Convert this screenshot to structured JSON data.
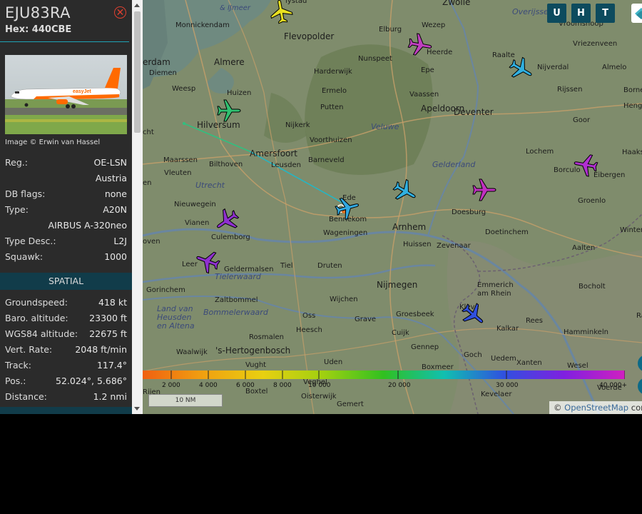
{
  "aircraft": {
    "callsign": "EJU83RA",
    "hex": "Hex: 440CBE",
    "photo_credit": "Image © Erwin van Hassel",
    "photo_livery_text": "easyJet",
    "info_rows": [
      {
        "label": "Reg.:",
        "value": "OE-LSN"
      },
      {
        "label": "",
        "value": "Austria"
      },
      {
        "label": "DB flags:",
        "value": "none"
      },
      {
        "label": "Type:",
        "value": "A20N"
      },
      {
        "label": "",
        "value": "AIRBUS A-320neo"
      },
      {
        "label": "Type Desc.:",
        "value": "L2J"
      },
      {
        "label": "Squawk:",
        "value": "1000"
      }
    ],
    "spatial_header": "SPATIAL",
    "spatial_rows": [
      {
        "label": "Groundspeed:",
        "value": "418 kt"
      },
      {
        "label": "Baro. altitude:",
        "value": "23300 ft"
      },
      {
        "label": "WGS84 altitude:",
        "value": "22675 ft"
      },
      {
        "label": "Vert. Rate:",
        "value": "2048 ft/min"
      },
      {
        "label": "Track:",
        "value": "117.4°"
      },
      {
        "label": "Pos.:",
        "value": "52.024°, 5.686°"
      },
      {
        "label": "Distance:",
        "value": "1.2 nmi"
      }
    ],
    "close_icon": "close-icon"
  },
  "map_buttons": {
    "u": "U",
    "h": "H",
    "t": "T",
    "layers_icon": "layers-icon"
  },
  "altitude_legend": {
    "labels": [
      "2 000",
      "4 000",
      "6 000",
      "8 000",
      "10 000",
      "20 000",
      "30 000",
      "40 000+"
    ],
    "colors": [
      "#f06010",
      "#f0a010",
      "#e8d010",
      "#a0d010",
      "#30c020",
      "#10c0b0",
      "#3050e0",
      "#8020e0",
      "#d020c0"
    ]
  },
  "scale_label": "10 NM",
  "attribution": {
    "copyright": "©",
    "link": "OpenStreetMap",
    "rest": "cor"
  },
  "places": [
    {
      "name": "lystad",
      "cls": "place"
    },
    {
      "name": "& IJmeer",
      "cls": "place water"
    },
    {
      "name": "Zwolle",
      "cls": "place big"
    },
    {
      "name": "Overijsse",
      "cls": "place region"
    },
    {
      "name": "Vroomshoop",
      "cls": "place"
    },
    {
      "name": "Monnickendam",
      "cls": "place"
    },
    {
      "name": "Flevopolder",
      "cls": "place big"
    },
    {
      "name": "Wezep",
      "cls": "place"
    },
    {
      "name": "Elburg",
      "cls": "place"
    },
    {
      "name": "Heerde",
      "cls": "place"
    },
    {
      "name": "Raalte",
      "cls": "place"
    },
    {
      "name": "Vriezenveen",
      "cls": "place"
    },
    {
      "name": "erdam",
      "cls": "place big"
    },
    {
      "name": "Almere",
      "cls": "place big"
    },
    {
      "name": "Nunspeet",
      "cls": "place"
    },
    {
      "name": "Nijverdal",
      "cls": "place"
    },
    {
      "name": "Almelo",
      "cls": "place"
    },
    {
      "name": "Diemen",
      "cls": "place"
    },
    {
      "name": "Harderwijk",
      "cls": "place"
    },
    {
      "name": "Epe",
      "cls": "place"
    },
    {
      "name": "Weesp",
      "cls": "place"
    },
    {
      "name": "Ermelo",
      "cls": "place"
    },
    {
      "name": "Rijssen",
      "cls": "place"
    },
    {
      "name": "Borne",
      "cls": "place"
    },
    {
      "name": "Huizen",
      "cls": "place"
    },
    {
      "name": "Vaassen",
      "cls": "place"
    },
    {
      "name": "Hengl",
      "cls": "place"
    },
    {
      "name": "Putten",
      "cls": "place"
    },
    {
      "name": "Deventer",
      "cls": "place big"
    },
    {
      "name": "Hilversum",
      "cls": "place big"
    },
    {
      "name": "Nijkerk",
      "cls": "place"
    },
    {
      "name": "Veluwe",
      "cls": "place region"
    },
    {
      "name": "Apeldoorn",
      "cls": "place big"
    },
    {
      "name": "Goor",
      "cls": "place"
    },
    {
      "name": "cht",
      "cls": "place"
    },
    {
      "name": "Voorthuizen",
      "cls": "place"
    },
    {
      "name": "Amersfoort",
      "cls": "place big"
    },
    {
      "name": "Lochem",
      "cls": "place"
    },
    {
      "name": "Haaksberge",
      "cls": "place"
    },
    {
      "name": "Maarssen",
      "cls": "place"
    },
    {
      "name": "Barneveld",
      "cls": "place"
    },
    {
      "name": "Gelderland",
      "cls": "place region"
    },
    {
      "name": "Bilthoven",
      "cls": "place"
    },
    {
      "name": "Leusden",
      "cls": "place"
    },
    {
      "name": "Borculo",
      "cls": "place"
    },
    {
      "name": "Eibergen",
      "cls": "place"
    },
    {
      "name": "Vleuten",
      "cls": "place"
    },
    {
      "name": "Utrecht",
      "cls": "place region"
    },
    {
      "name": "en",
      "cls": "place"
    },
    {
      "name": "Groenlo",
      "cls": "place"
    },
    {
      "name": "Nieuwegein",
      "cls": "place"
    },
    {
      "name": "Ede",
      "cls": "place"
    },
    {
      "name": "Doesburg",
      "cls": "place"
    },
    {
      "name": "Bennekom",
      "cls": "place"
    },
    {
      "name": "Vianen",
      "cls": "place"
    },
    {
      "name": "Arnhem",
      "cls": "place big"
    },
    {
      "name": "Winterswijk",
      "cls": "place"
    },
    {
      "name": "Wageningen",
      "cls": "place"
    },
    {
      "name": "Doetinchem",
      "cls": "place"
    },
    {
      "name": "Culemborg",
      "cls": "place"
    },
    {
      "name": "oven",
      "cls": "place"
    },
    {
      "name": "Huissen",
      "cls": "place"
    },
    {
      "name": "Zevenaar",
      "cls": "place"
    },
    {
      "name": "Aalten",
      "cls": "place"
    },
    {
      "name": "Leer",
      "cls": "place"
    },
    {
      "name": "Tiel",
      "cls": "place"
    },
    {
      "name": "Druten",
      "cls": "place"
    },
    {
      "name": "Geldermalsen",
      "cls": "place"
    },
    {
      "name": "Tielerwaard",
      "cls": "place region"
    },
    {
      "name": "Nijmegen",
      "cls": "place big"
    },
    {
      "name": "Emmerich",
      "cls": "place"
    },
    {
      "name": "am Rhein",
      "cls": "place"
    },
    {
      "name": "Gorinchem",
      "cls": "place"
    },
    {
      "name": "Bocholt",
      "cls": "place"
    },
    {
      "name": "Zaltbommel",
      "cls": "place"
    },
    {
      "name": "Wijchen",
      "cls": "place"
    },
    {
      "name": "Kleve",
      "cls": "place"
    },
    {
      "name": "Land van",
      "cls": "place region"
    },
    {
      "name": "Heusden",
      "cls": "place region"
    },
    {
      "name": "en Altena",
      "cls": "place region"
    },
    {
      "name": "Bommelerwaard",
      "cls": "place region"
    },
    {
      "name": "Oss",
      "cls": "place"
    },
    {
      "name": "Grave",
      "cls": "place"
    },
    {
      "name": "Groesbeek",
      "cls": "place"
    },
    {
      "name": "Rees",
      "cls": "place"
    },
    {
      "name": "Ra",
      "cls": "place"
    },
    {
      "name": "Heesch",
      "cls": "place"
    },
    {
      "name": "Cuijk",
      "cls": "place"
    },
    {
      "name": "Kalkar",
      "cls": "place"
    },
    {
      "name": "Hamminkeln",
      "cls": "place"
    },
    {
      "name": "Rosmalen",
      "cls": "place"
    },
    {
      "name": "Gennep",
      "cls": "place"
    },
    {
      "name": "Waalwijk",
      "cls": "place"
    },
    {
      "name": "'s-Hertogenbosch",
      "cls": "place big"
    },
    {
      "name": "Goch",
      "cls": "place"
    },
    {
      "name": "Uedem",
      "cls": "place"
    },
    {
      "name": "Xanten",
      "cls": "place"
    },
    {
      "name": "Uden",
      "cls": "place"
    },
    {
      "name": "Wesel",
      "cls": "place"
    },
    {
      "name": "Vught",
      "cls": "place"
    },
    {
      "name": "Boxmeer",
      "cls": "place"
    },
    {
      "name": "Veghel",
      "cls": "place"
    },
    {
      "name": "Voerde",
      "cls": "place"
    },
    {
      "name": "Rijen",
      "cls": "place"
    },
    {
      "name": "Boxtel",
      "cls": "place"
    },
    {
      "name": "Oisterwijk",
      "cls": "place"
    },
    {
      "name": "Gemert",
      "cls": "place"
    },
    {
      "name": "Kevelaer",
      "cls": "place"
    }
  ],
  "planes": [
    {
      "name": "aircraft-yellow",
      "color": "#e8e020",
      "angle": -10
    },
    {
      "name": "aircraft-violet-wezep",
      "color": "#c040c0",
      "angle": 100
    },
    {
      "name": "aircraft-cyan-raalte",
      "color": "#30b0e0",
      "angle": 120
    },
    {
      "name": "aircraft-green-hilversum",
      "color": "#30c070",
      "angle": 90
    },
    {
      "name": "aircraft-magenta-borculo",
      "color": "#b030d0",
      "angle": -80
    },
    {
      "name": "aircraft-cyan-ede",
      "color": "#30a8e0",
      "angle": 75
    },
    {
      "name": "aircraft-cyan-arnhem",
      "color": "#30b0e0",
      "angle": 120
    },
    {
      "name": "aircraft-magenta-doesburg",
      "color": "#c030c0",
      "angle": 90
    },
    {
      "name": "aircraft-purple-culemborg",
      "color": "#9030d0",
      "angle": -125
    },
    {
      "name": "aircraft-purple-leer",
      "color": "#9030d0",
      "angle": -70
    },
    {
      "name": "aircraft-blue-kleve",
      "color": "#3050e0",
      "angle": 130
    }
  ]
}
